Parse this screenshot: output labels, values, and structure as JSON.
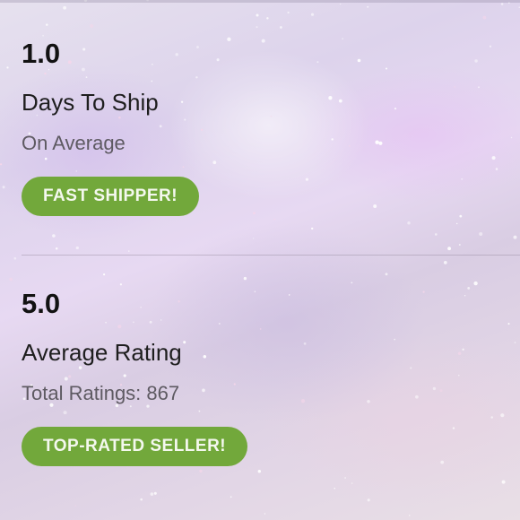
{
  "shipping": {
    "value": "1.0",
    "label": "Days To Ship",
    "subtext": "On Average",
    "badge": "FAST SHIPPER!"
  },
  "rating": {
    "value": "5.0",
    "label": "Average Rating",
    "subtext": "Total Ratings: 867",
    "badge": "TOP-RATED SELLER!"
  },
  "colors": {
    "badge_green": "#72a83b",
    "text_dark": "#121212",
    "text_muted": "#5e5a62"
  }
}
